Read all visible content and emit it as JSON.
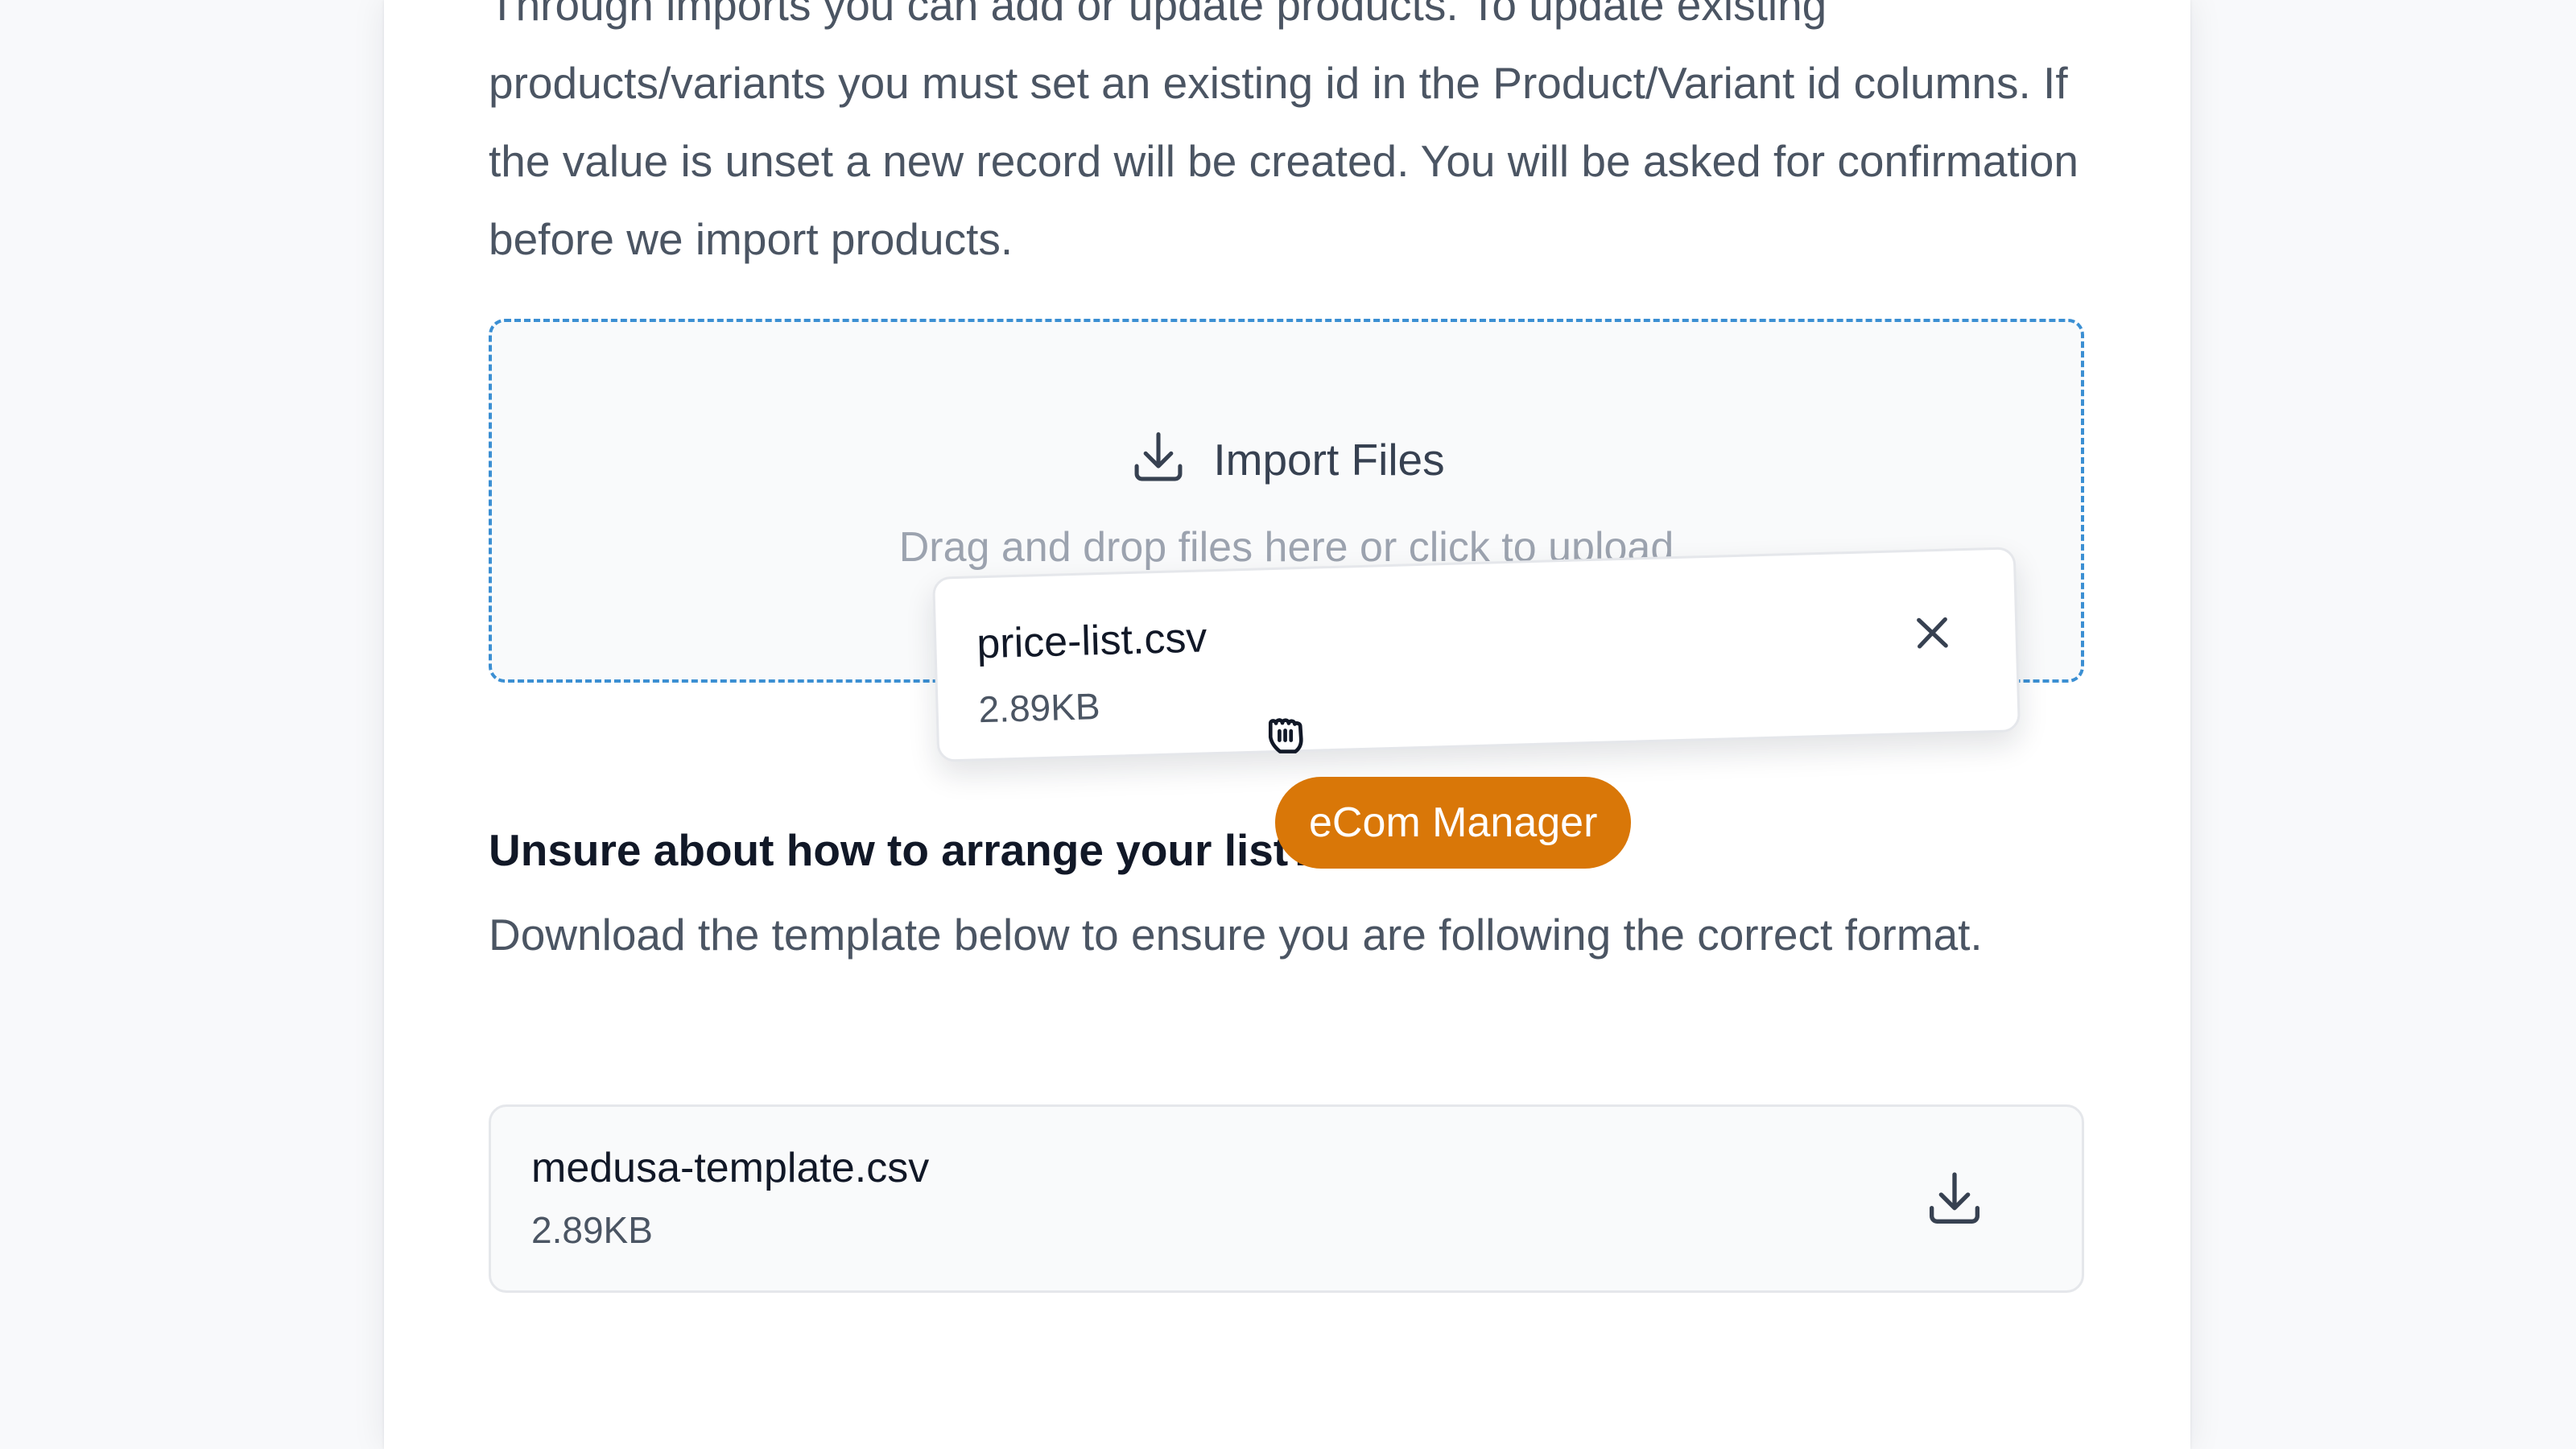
{
  "intro": {
    "text": "Through imports you can add or update products. To update existing products/variants you must set an existing id in the Product/Variant id columns. If the value is unset a new record will be created. You will be asked for confirmation before we import products."
  },
  "dropzone": {
    "title": "Import Files",
    "icon": "download-icon",
    "hint": "Drag and drop files here or click to upload",
    "accent_color": "#3b8fd3"
  },
  "dragged_file": {
    "name": "price-list.csv",
    "size": "2.89KB",
    "remove_icon": "close-icon"
  },
  "cursor": {
    "icon": "grab-hand-icon",
    "user_label": "eCom Manager",
    "label_color": "#d97708"
  },
  "help": {
    "heading": "Unsure about how to arrange your list?",
    "text": "Download the template below to ensure you are following the correct format."
  },
  "template_file": {
    "name": "medusa-template.csv",
    "size": "2.89KB",
    "download_icon": "download-icon"
  }
}
